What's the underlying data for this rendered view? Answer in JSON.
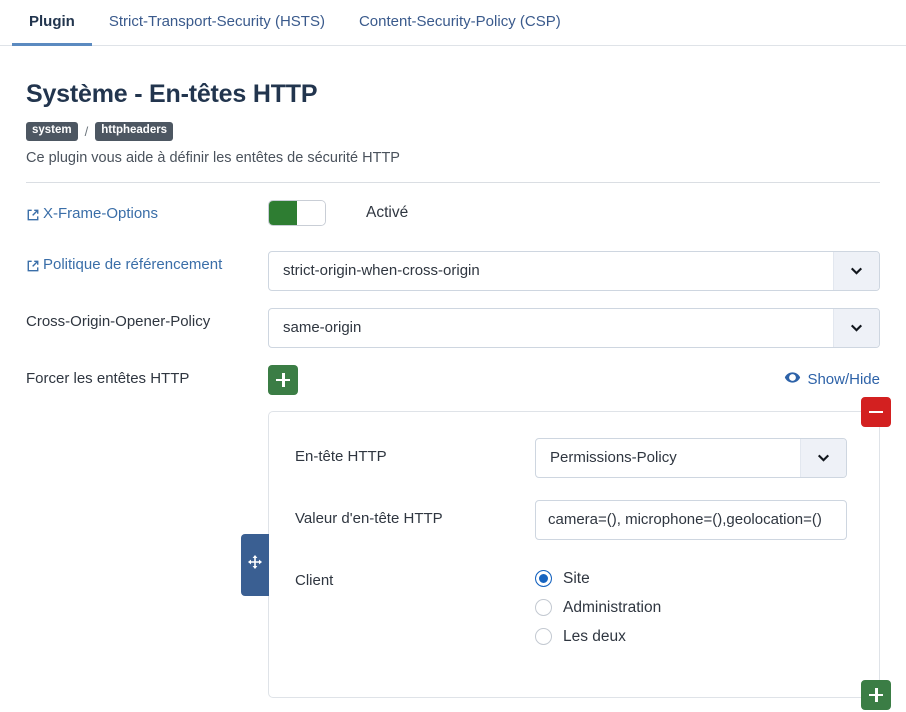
{
  "tabs": [
    {
      "label": "Plugin",
      "active": true
    },
    {
      "label": "Strict-Transport-Security (HSTS)",
      "active": false
    },
    {
      "label": "Content-Security-Policy (CSP)",
      "active": false
    }
  ],
  "header": {
    "title": "Système - En-têtes HTTP",
    "badge_group": "system",
    "badge_separator": "/",
    "badge_name": "httpheaders",
    "description": "Ce plugin vous aide à définir les entêtes de sécurité HTTP"
  },
  "fields": {
    "xframe": {
      "label": "X-Frame-Options",
      "icon": "external-link-icon",
      "toggle_state": "on",
      "state_text": "Activé"
    },
    "referrer": {
      "label": "Politique de référencement",
      "icon": "external-link-icon",
      "value": "strict-origin-when-cross-origin",
      "caret_icon": "chevron-down-icon"
    },
    "coop": {
      "label": "Cross-Origin-Opener-Policy",
      "value": "same-origin",
      "caret_icon": "chevron-down-icon"
    },
    "force_headers": {
      "label": "Forcer les entêtes HTTP",
      "add_button_icon": "plus-icon",
      "showhide_label": "Show/Hide",
      "showhide_icon": "eye-icon"
    }
  },
  "repeat_panel": {
    "drag_icon": "move-arrows-icon",
    "remove_button_icon": "minus-icon",
    "add_button_icon": "plus-icon",
    "header_name": {
      "label": "En-tête HTTP",
      "value": "Permissions-Policy",
      "caret_icon": "chevron-down-icon"
    },
    "header_value": {
      "label": "Valeur d'en-tête HTTP",
      "value": "camera=(), microphone=(),geolocation=()",
      "placeholder": ""
    },
    "client": {
      "label": "Client",
      "options": [
        {
          "label": "Site",
          "checked": true
        },
        {
          "label": "Administration",
          "checked": false
        },
        {
          "label": "Les deux",
          "checked": false
        }
      ]
    }
  },
  "colors": {
    "accent_blue": "#3a6ea8",
    "tab_active_underline": "#5b8ac0",
    "toggle_on_green": "#2e7d32",
    "button_green": "#3b7d45",
    "button_red": "#d32020",
    "drag_handle_blue": "#3a5f92",
    "radio_checked_blue": "#1764c0",
    "badge_gray": "#4d5762"
  }
}
